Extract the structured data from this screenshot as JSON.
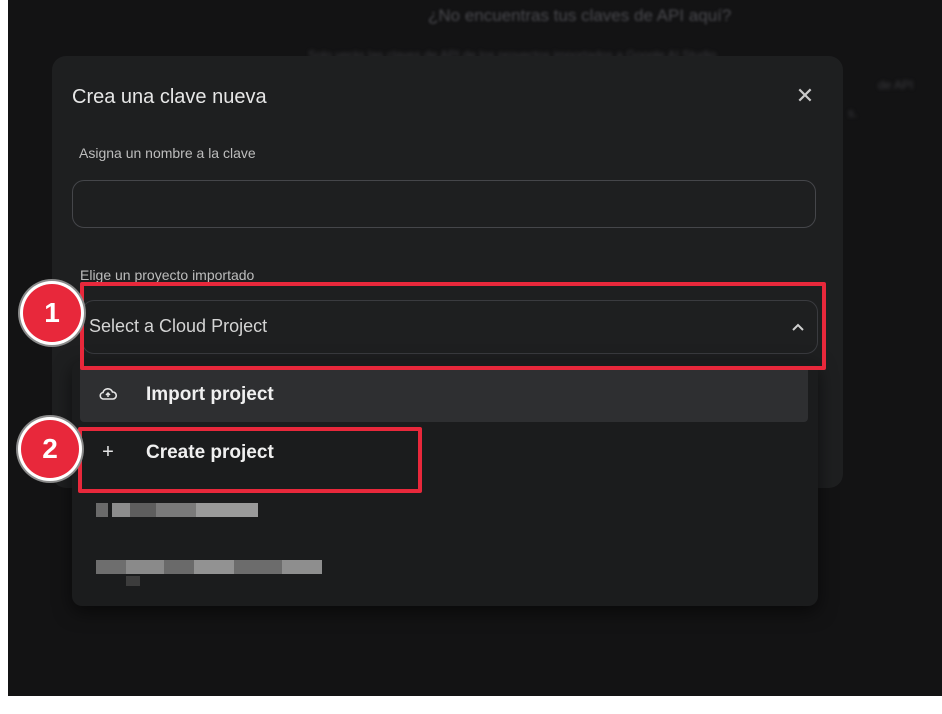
{
  "background": {
    "heading": "¿No encuentras tus claves de API aquí?",
    "text_lines": [
      "Solo verás las claves de API de los proyectos importados a Google AI Studio",
      "de API",
      "s."
    ]
  },
  "dialog": {
    "title": "Crea una clave nueva",
    "close_icon": "✕",
    "name_field": {
      "label": "Asigna un nombre a la clave",
      "value": "",
      "placeholder": ""
    },
    "project_field": {
      "label": "Elige un proyecto importado",
      "selected": "Select a Cloud Project"
    },
    "dropdown": {
      "items": [
        {
          "icon": "cloud-upload-icon",
          "glyph": "☁",
          "label": "Import project"
        },
        {
          "icon": "plus-icon",
          "glyph": "+",
          "label": "Create project"
        }
      ]
    }
  },
  "annotations": [
    {
      "number": "1"
    },
    {
      "number": "2"
    }
  ],
  "colors": {
    "annotation_red": "#e8283b",
    "screen_bg": "#131314",
    "dialog_bg": "#1e1f20"
  }
}
